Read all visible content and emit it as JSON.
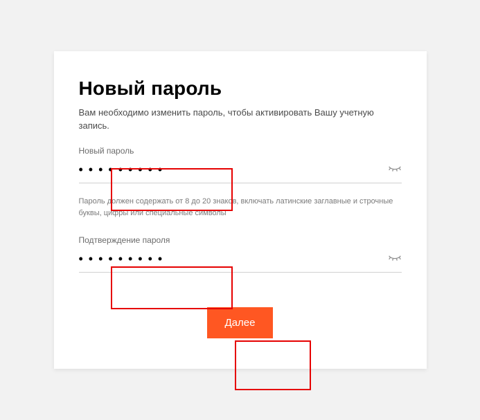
{
  "page": {
    "title": "Новый пароль",
    "subtitle": "Вам необходимо изменить пароль, чтобы активировать Вашу учетную запись."
  },
  "fields": {
    "new_password": {
      "label": "Новый пароль",
      "value": "•••••••••"
    },
    "confirm_password": {
      "label": "Подтверждение пароля",
      "value": "•••••••••"
    }
  },
  "hint": "Пароль должен содержать от 8 до 20 знаков, включать латинские заглавные и строчные буквы, цифры или специальные символы",
  "actions": {
    "submit_label": "Далее"
  },
  "colors": {
    "accent": "#ff5722",
    "highlight": "#e60000"
  }
}
